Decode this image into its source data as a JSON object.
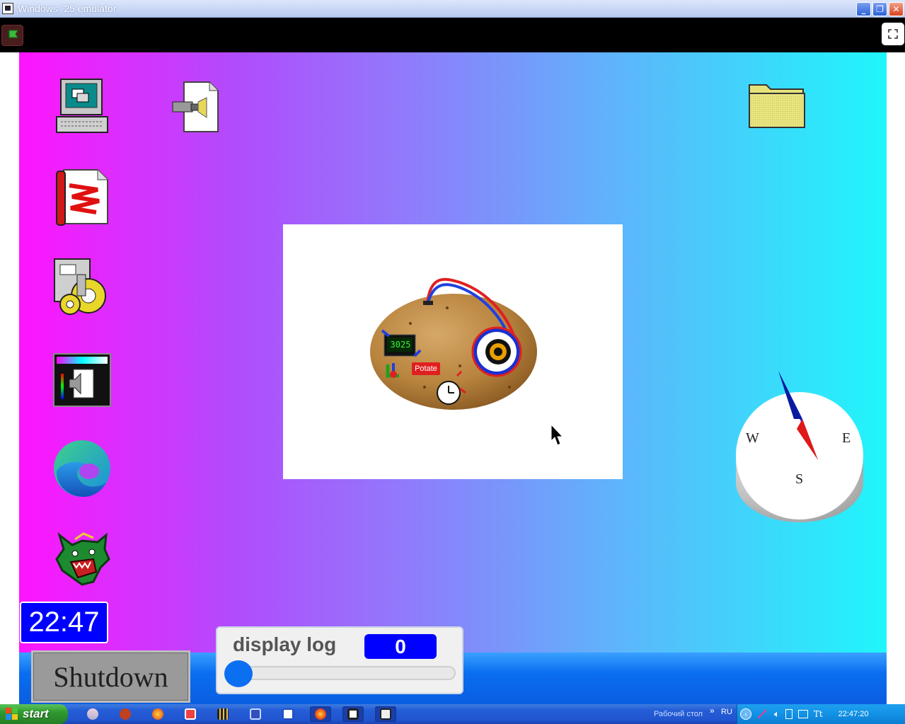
{
  "window": {
    "title": "Windows `25 emulator"
  },
  "stage": {
    "desktop_icons": [
      {
        "name": "my-computer-icon"
      },
      {
        "name": "video-file-icon"
      },
      {
        "name": "folder-icon"
      },
      {
        "name": "paint-file-icon"
      },
      {
        "name": "setup-gears-icon"
      },
      {
        "name": "sound-settings-icon"
      },
      {
        "name": "edge-browser-icon"
      },
      {
        "name": "dragon-icon"
      }
    ],
    "viewer": {
      "label": "Potate",
      "clock_display": "3025"
    },
    "compass": {
      "west": "W",
      "east": "E",
      "south": "S"
    },
    "clock": "22:47",
    "display_log": {
      "label": "display log",
      "value": "0",
      "slider_level": 0
    },
    "shutdown_label": "Shutdown"
  },
  "taskbar": {
    "start_label": "start",
    "desktop_label": "Рабочий стол",
    "chevron": "»",
    "language": "RU",
    "time": "22:47:20"
  },
  "colors": {
    "accent": "#0000ff",
    "taskbar": "#245ed7",
    "start_green": "#2f9a2f"
  }
}
